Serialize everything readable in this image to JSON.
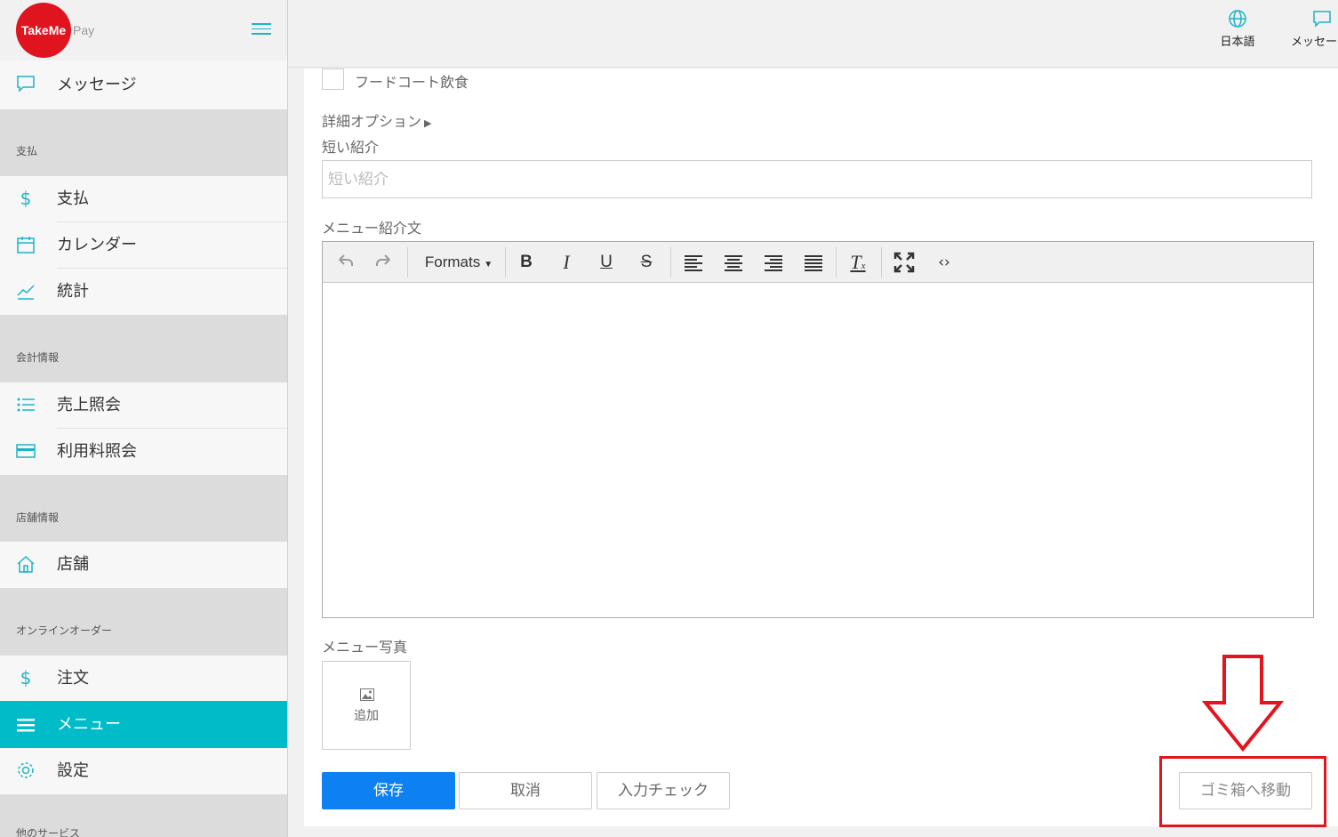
{
  "logo": {
    "brand": "TakeMe",
    "suffix": "Pay"
  },
  "topbar": {
    "language_label": "日本語",
    "messages_label": "メッセージ"
  },
  "sidebar": {
    "message_item": "メッセージ",
    "sections": [
      "支払",
      "会計情報",
      "店舗情報",
      "オンラインオーダー",
      "他のサービス"
    ],
    "items": [
      "支払",
      "カレンダー",
      "統計",
      "売上照会",
      "利用料照会",
      "店舗",
      "注文",
      "メニュー",
      "設定"
    ],
    "active_item": "メニュー"
  },
  "form": {
    "checkbox_label": "フードコート飲食",
    "advanced_options": "詳細オプション",
    "short_intro_label": "短い紹介",
    "short_intro_placeholder": "短い紹介",
    "short_intro_value": "",
    "menu_description_label": "メニュー紹介文",
    "editor_formats": "Formats",
    "photo_label": "メニュー写真",
    "photo_add": "追加"
  },
  "actions": {
    "save": "保存",
    "cancel": "取消",
    "validate": "入力チェック",
    "trash": "ゴミ箱へ移動"
  },
  "colors": {
    "accent": "#00bcc9",
    "primary": "#0d80f2",
    "logo": "#e0141f",
    "annotation": "#e3141c"
  }
}
